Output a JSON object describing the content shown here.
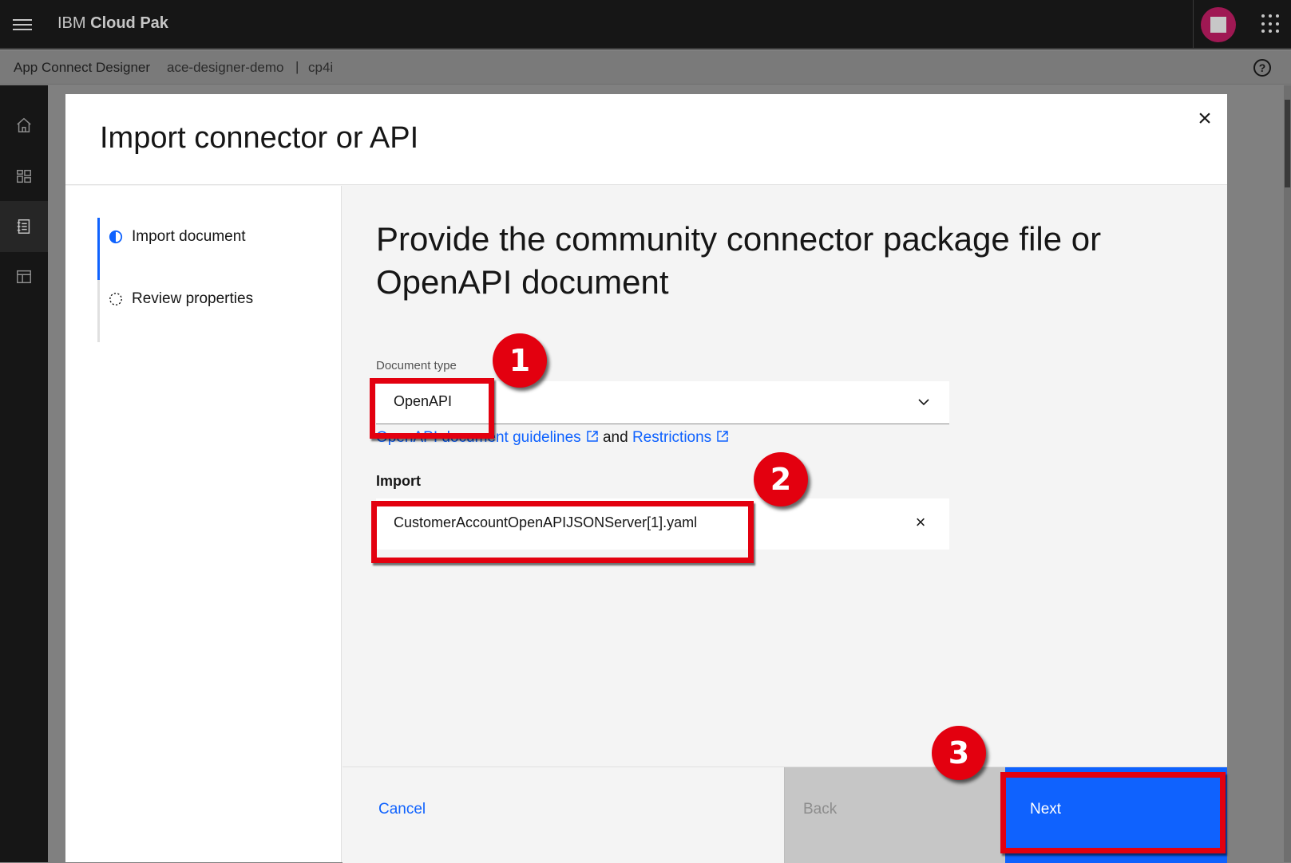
{
  "header": {
    "brand_prefix": "IBM",
    "brand_name": "Cloud Pak"
  },
  "subheader": {
    "app": "App Connect Designer",
    "instance": "ace-designer-demo",
    "separator": "|",
    "namespace": "cp4i"
  },
  "rail": {
    "icons": [
      "home-icon",
      "dashboard-icon",
      "catalog-icon",
      "templates-icon"
    ],
    "active": "catalog-icon"
  },
  "modal": {
    "title": "Import connector or API",
    "steps": [
      {
        "label": "Import document",
        "state": "current"
      },
      {
        "label": "Review properties",
        "state": "incomplete"
      }
    ],
    "heading": "Provide the community connector package file or OpenAPI document",
    "document_type": {
      "label": "Document type",
      "value": "OpenAPI"
    },
    "links": {
      "guidelines": "OpenAPI document guidelines",
      "and": "and",
      "restrictions": "Restrictions"
    },
    "import": {
      "label": "Import",
      "filename": "CustomerAccountOpenAPIJSONServer[1].yaml"
    },
    "footer": {
      "cancel": "Cancel",
      "back": "Back",
      "next": "Next"
    }
  },
  "annotations": {
    "badges": [
      "1",
      "2",
      "3"
    ],
    "color": "#e3000f"
  },
  "colors": {
    "accent": "#0f62fe",
    "header_bg": "#161616",
    "avatar": "#9f1853"
  }
}
